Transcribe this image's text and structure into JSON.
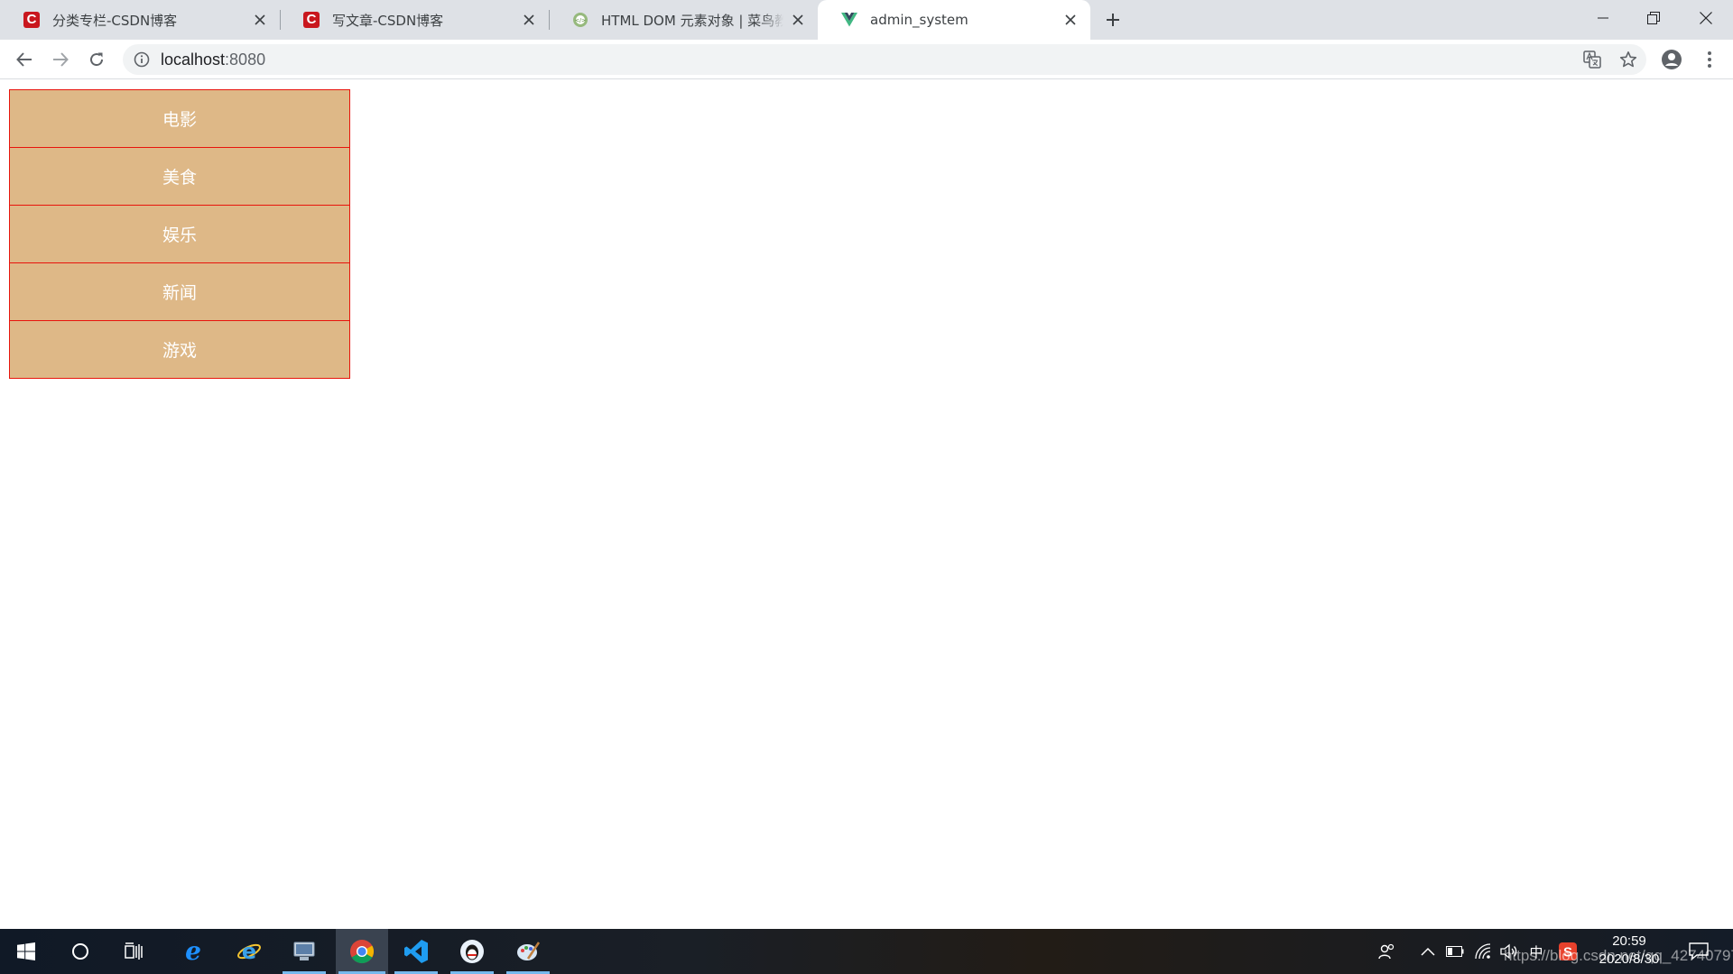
{
  "browser": {
    "tabs": [
      {
        "title": "分类专栏-CSDN博客",
        "icon": "csdn-icon",
        "active": false
      },
      {
        "title": "写文章-CSDN博客",
        "icon": "csdn-icon",
        "active": false
      },
      {
        "title": "HTML DOM 元素对象 | 菜鸟教程",
        "icon": "runoob-icon",
        "active": false
      },
      {
        "title": "admin_system",
        "icon": "vue-icon",
        "active": true
      }
    ],
    "address": {
      "host": "localhost",
      "port": ":8080"
    }
  },
  "menu": {
    "items": [
      "电影",
      "美食",
      "娱乐",
      "新闻",
      "游戏"
    ]
  },
  "taskbar": {
    "time": "20:59",
    "date": "2020/8/30",
    "ime": "中",
    "watermark": "https://blog.csdn.net/qq_42740797"
  },
  "colors": {
    "menu_bg": "#deb887",
    "menu_border": "#e8140c",
    "menu_text": "#ffffff",
    "tabstrip_bg": "#dee1e6",
    "taskbar_bg": "#131a24"
  }
}
